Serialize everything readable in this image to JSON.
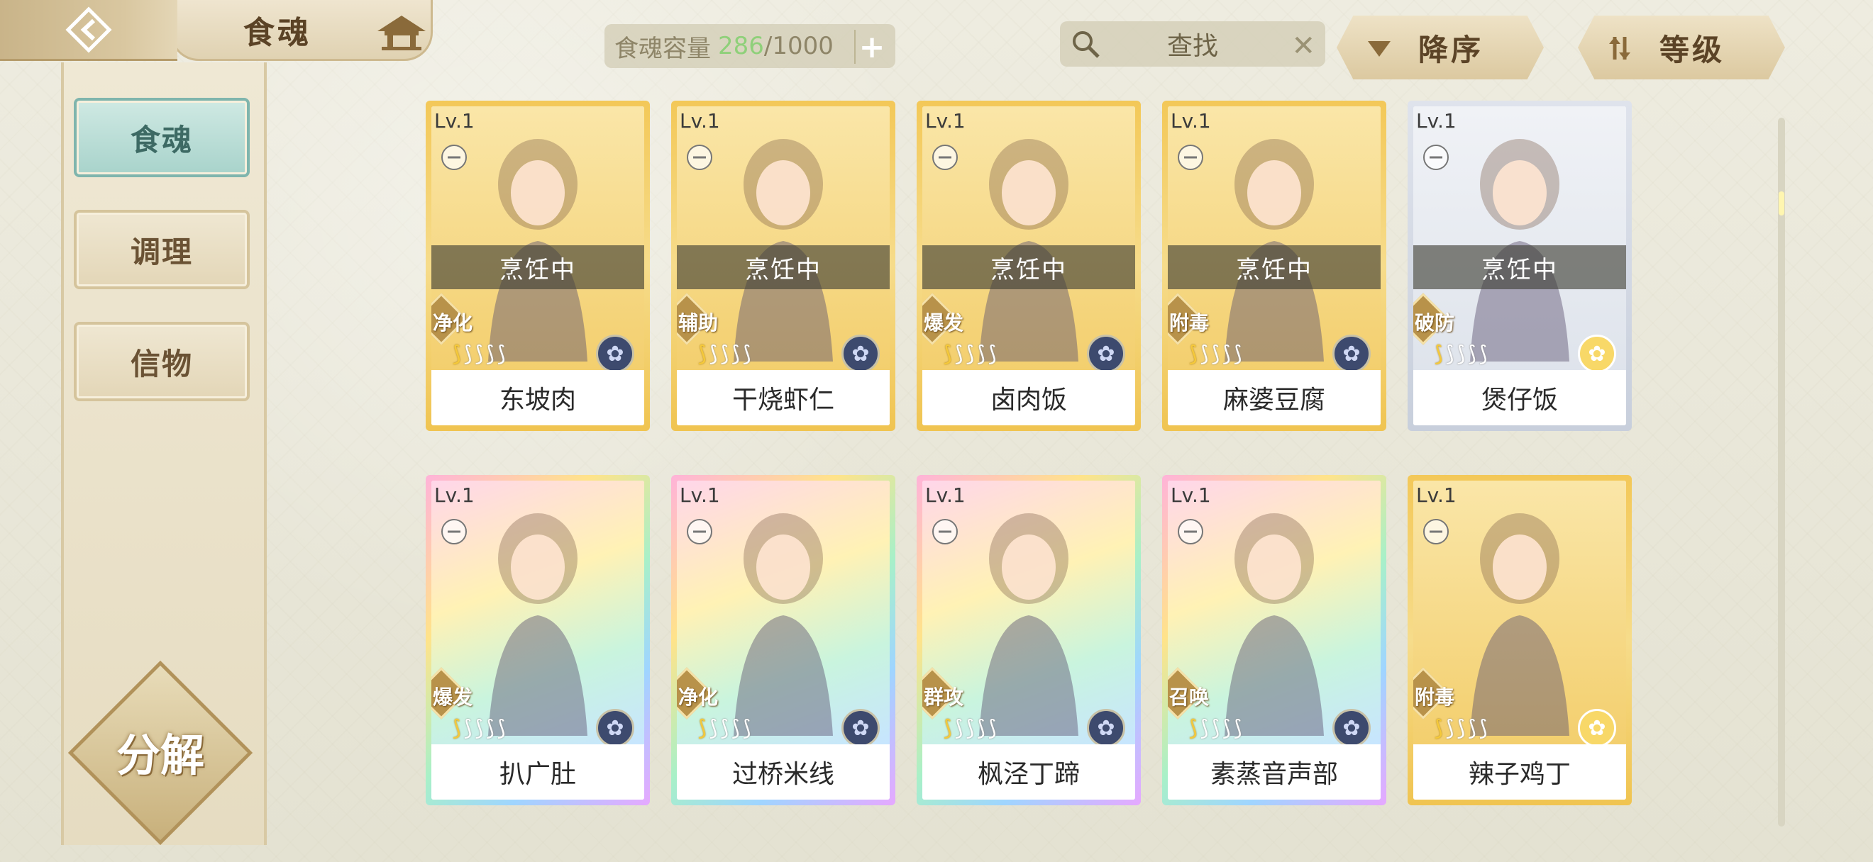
{
  "header": {
    "title": "食魂",
    "capacity_label": "食魂容量",
    "capacity_current": "286",
    "capacity_max": "/1000",
    "search_placeholder": "查找",
    "sort_order_label": "降序",
    "sort_key_label": "等级"
  },
  "sidebar": {
    "items": [
      {
        "label": "食魂",
        "active": true
      },
      {
        "label": "调理",
        "active": false
      },
      {
        "label": "信物",
        "active": false
      }
    ],
    "decompose_label": "分解"
  },
  "cards": [
    {
      "level": "Lv.1",
      "name": "东坡肉",
      "status": "烹饪中",
      "role": "净化",
      "stars": 1,
      "frame": "gold",
      "emblem": "navy"
    },
    {
      "level": "Lv.1",
      "name": "干烧虾仁",
      "status": "烹饪中",
      "role": "辅助",
      "stars": 1,
      "frame": "gold",
      "emblem": "navy"
    },
    {
      "level": "Lv.1",
      "name": "卤肉饭",
      "status": "烹饪中",
      "role": "爆发",
      "stars": 1,
      "frame": "gold",
      "emblem": "navy"
    },
    {
      "level": "Lv.1",
      "name": "麻婆豆腐",
      "status": "烹饪中",
      "role": "附毒",
      "stars": 1,
      "frame": "gold",
      "emblem": "navy"
    },
    {
      "level": "Lv.1",
      "name": "煲仔饭",
      "status": "烹饪中",
      "role": "破防",
      "stars": 1,
      "frame": "silver",
      "emblem": "gold"
    },
    {
      "level": "Lv.1",
      "name": "扒广肚",
      "status": "",
      "role": "爆发",
      "stars": 1,
      "frame": "rainbow",
      "emblem": "navy"
    },
    {
      "level": "Lv.1",
      "name": "过桥米线",
      "status": "",
      "role": "净化",
      "stars": 1,
      "frame": "rainbow",
      "emblem": "navy"
    },
    {
      "level": "Lv.1",
      "name": "枫泾丁蹄",
      "status": "",
      "role": "群攻",
      "stars": 1,
      "frame": "rainbow",
      "emblem": "navy"
    },
    {
      "level": "Lv.1",
      "name": "素蒸音声部",
      "status": "",
      "role": "召唤",
      "stars": 1,
      "frame": "rainbow",
      "emblem": "navy"
    },
    {
      "level": "Lv.1",
      "name": "辣子鸡丁",
      "status": "",
      "role": "附毒",
      "stars": 1,
      "frame": "gold",
      "emblem": "gold"
    }
  ],
  "colors": {
    "capacity_current": "#8fd07a",
    "active_tab": "#a8d3cb",
    "gold_frame": "#f3c858",
    "star_on": "#f5c93a"
  },
  "icons": {
    "back": "back-arrow-icon",
    "home": "pavilion-icon",
    "search": "search-icon",
    "clear": "close-icon",
    "add": "plus-icon",
    "sort_order": "down-triangle-icon",
    "sort_key": "sort-bars-icon"
  }
}
